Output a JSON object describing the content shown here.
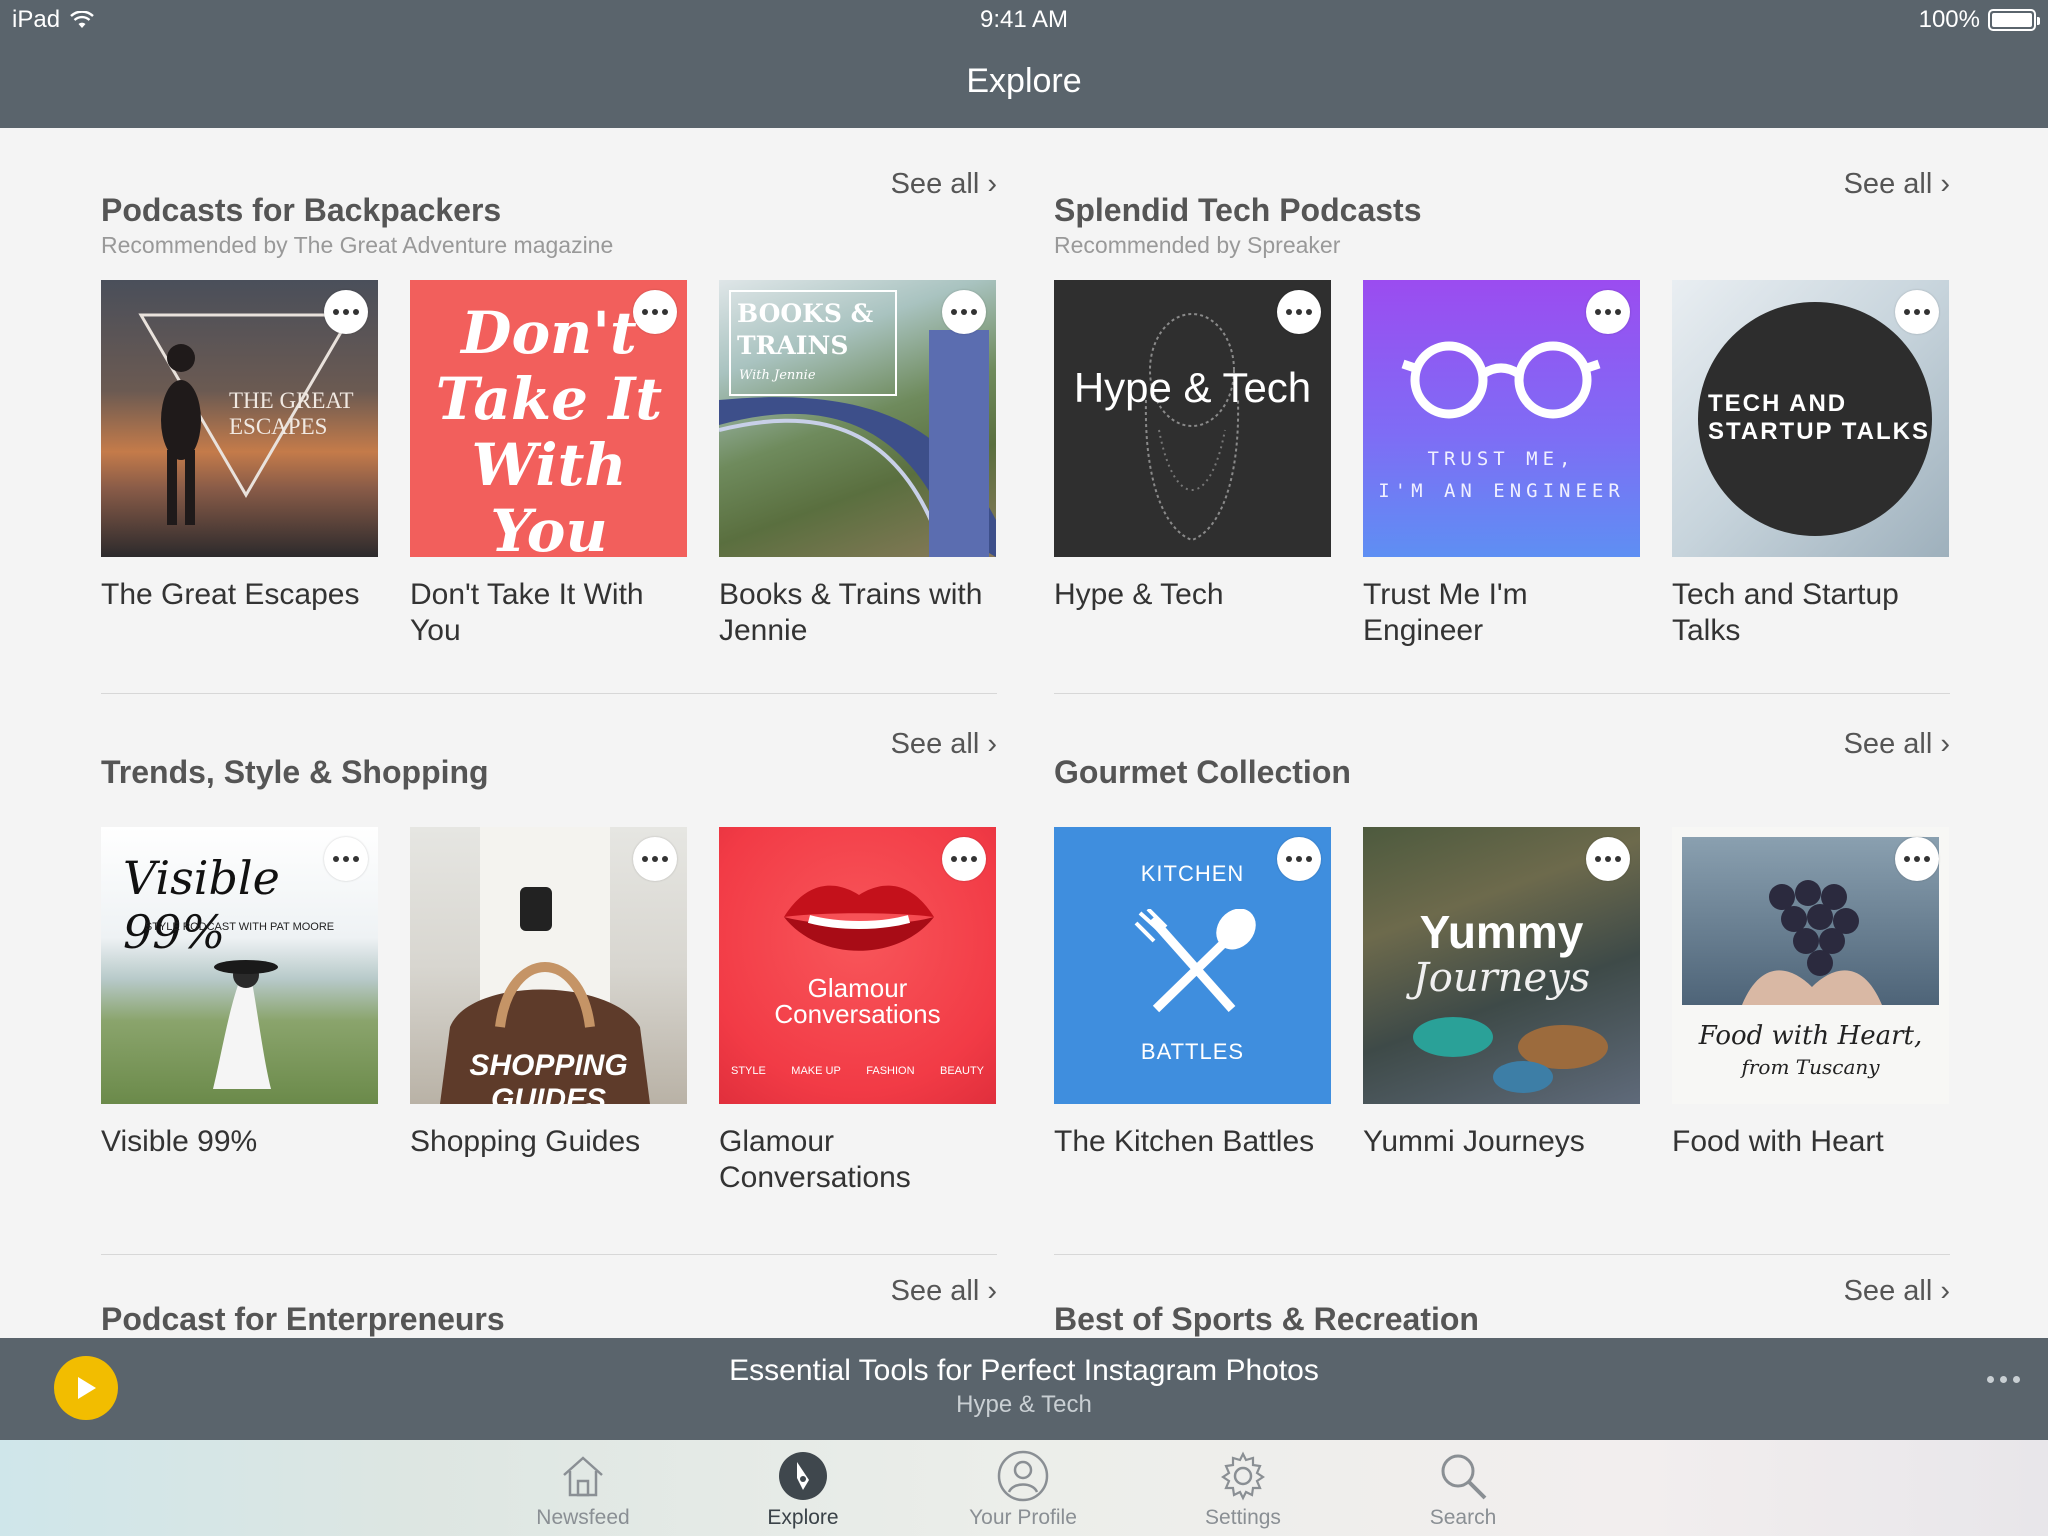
{
  "status_bar": {
    "device": "iPad",
    "time": "9:41 AM",
    "battery": "100%"
  },
  "header": {
    "title": "Explore"
  },
  "sections": [
    {
      "title": "Podcasts for Backpackers",
      "subtitle": "Recommended by The Great Adventure magazine",
      "see_all": "See all",
      "items": [
        {
          "title": "The Great Escapes",
          "art_text": "THE GREAT ESCAPES"
        },
        {
          "title": "Don't Take It With You",
          "art_text": "Don't Take It With You"
        },
        {
          "title": "Books & Trains with Jennie",
          "art_text": "BOOKS & TRAINS",
          "art_sub": "With Jennie"
        }
      ]
    },
    {
      "title": "Splendid Tech Podcasts",
      "subtitle": "Recommended by Spreaker",
      "see_all": "See all",
      "items": [
        {
          "title": "Hype & Tech",
          "art_text": "Hype & Tech"
        },
        {
          "title": "Trust Me I'm Engineer",
          "art_text": "TRUST ME,",
          "art_sub": "I'M AN ENGINEER"
        },
        {
          "title": "Tech and Startup Talks",
          "art_text": "TECH AND",
          "art_sub": "STARTUP TALKS"
        }
      ]
    },
    {
      "title": "Trends, Style & Shopping",
      "see_all": "See all",
      "items": [
        {
          "title": "Visible 99%",
          "art_text": "Visible 99%",
          "art_sub": "STYLE PODCAST WITH PAT MOORE"
        },
        {
          "title": "Shopping Guides",
          "art_text": "SHOPPING GUIDES"
        },
        {
          "title": "Glamour Conversations",
          "art_text": "Glamour",
          "art_sub": "Conversations",
          "art_tags": [
            "STYLE",
            "MAKE UP",
            "FASHION",
            "BEAUTY"
          ]
        }
      ]
    },
    {
      "title": "Gourmet Collection",
      "see_all": "See all",
      "items": [
        {
          "title": "The Kitchen Battles",
          "art_text": "KITCHEN",
          "art_sub": "BATTLES"
        },
        {
          "title": "Yummi Journeys",
          "art_text": "Yummy",
          "art_sub": "Journeys"
        },
        {
          "title": "Food with Heart",
          "art_text": "Food with Heart,",
          "art_sub": "from Tuscany"
        }
      ]
    },
    {
      "title": "Podcast for Enterpreneurs",
      "see_all": "See all"
    },
    {
      "title": "Best of Sports & Recreation",
      "see_all": "See all"
    }
  ],
  "now_playing": {
    "title": "Essential Tools for Perfect Instagram Photos",
    "podcast": "Hype & Tech"
  },
  "tabs": [
    {
      "label": "Newsfeed",
      "icon": "house-icon"
    },
    {
      "label": "Explore",
      "icon": "compass-icon",
      "active": true
    },
    {
      "label": "Your Profile",
      "icon": "person-icon"
    },
    {
      "label": "Settings",
      "icon": "gear-icon"
    },
    {
      "label": "Search",
      "icon": "magnifier-icon"
    }
  ],
  "colors": {
    "header_bg": "#5a646c",
    "play_button": "#f2bd00",
    "page_bg": "#f4f4f4"
  }
}
